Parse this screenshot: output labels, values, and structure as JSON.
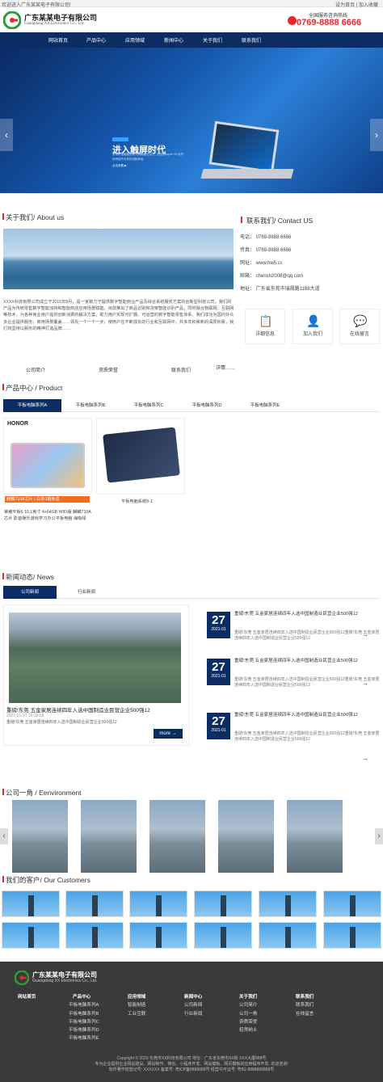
{
  "topbar": {
    "welcome": "欢迎进入广东某某电子有限公司!",
    "links": [
      "设为首页",
      "|",
      "加入收藏"
    ]
  },
  "header": {
    "company_cn": "广东某某电子有限公司",
    "company_en": "Guangdong XX Electronics Co., Ltd.",
    "hotline_label": "全国服务咨询热线",
    "hotline": "0769-8888 6666"
  },
  "nav": [
    "网站首页",
    "产品中心",
    "应用领域",
    "新闻中心",
    "关于我们",
    "联系我们"
  ],
  "banner": {
    "tag": "Aspire V5",
    "headline": "进入触屏时代",
    "sub1": "采用防误触触控和大屏幕触控设计, 让您的Aspire V5 系列",
    "sub2": "获得前所未有的流畅体验",
    "button": "点击查看 ▶",
    "prev": "‹",
    "next": "›"
  },
  "about": {
    "title": "关于我们/ About us",
    "text": "XXXX科技有限公司成立于2015年8月，是一家致力于提供数字智能商业产品及综合系统服务方案的创新型科技公司。我们的产品为传统零售数字智能加持和智能商店应用场景赋能。目前推出了商品识别和货架智能识别产品，同时融合物联网、互联网等技术，为各种商业用户提供创新消费的解决方案，助力用户实现可扩展、可运营的数字智能零售体系。我们成功为国内外众多企业提供服务，商用场景覆盖……领先一个一个一步，使用户在不断成长的行业和互联网中，并多年积累新的深厚积累，我们将坚持以服务的精神打造品牌……",
    "links": [
      "公司简介",
      "资质荣誉",
      "联系我们",
      "详情……"
    ]
  },
  "contact": {
    "title": "联系我们/ Contact US",
    "rows": [
      "电话：   0769-8888 6666",
      "传真：   0769-8888 6666",
      "网址：   www.hw5.cc",
      "邮箱：   chensh2008@qq.com",
      "地址：   广东省东莞市瑞晟路1188大道"
    ],
    "boxes": [
      {
        "icon": "📋",
        "label": "详细信息"
      },
      {
        "icon": "👤",
        "label": "加入我们"
      },
      {
        "icon": "💬",
        "label": "在线留言"
      }
    ]
  },
  "product": {
    "title": "产品中心 / Product",
    "tabs": [
      "平板电脑系列A",
      "平板电脑系列B",
      "平板电脑系列C",
      "平板电脑系列D",
      "平板电脑系列E"
    ],
    "items": [
      {
        "brand": "HONOR",
        "badge": "麒麟710A芯片 | 白条3期免息",
        "caption": "荣耀平板6 10.1英寸 4+64GB WIFI版 麒麟710A芯片 影音娱乐游戏学习办公平板电脑 海吸绿"
      },
      {
        "caption": "平板电脑系统8-1"
      }
    ]
  },
  "news": {
    "title": "新闻动态/ News",
    "tabs": [
      "公司新闻",
      "行业新闻"
    ],
    "main": {
      "title": "重磅!东莞 五金家居连续四年入选中国制造业民营企业500强12",
      "date": "2021-01-27 10:38:58",
      "desc": "重磅!东莞 五金家居连续四年入选中国制造业民营企业500强12",
      "more": "more →"
    },
    "list": [
      {
        "day": "27",
        "ym": "2021-01",
        "title": "重磅!东莞 五金家居连续四年入选中国制造业民营企业500强12",
        "desc": "重磅!东莞 五金家居连续四年入选中国制造业民营企业500强12重磅!东莞 五金家居连续四年入选中国制造业民营企业500强12",
        "arrow": "→"
      },
      {
        "day": "27",
        "ym": "2021-01",
        "title": "重磅!东莞 五金家居连续四年入选中国制造业民营企业500强12",
        "desc": "重磅!东莞 五金家居连续四年入选中国制造业民营企业500强12重磅!东莞 五金家居连续四年入选中国制造业民营企业500强12",
        "arrow": "→"
      },
      {
        "day": "27",
        "ym": "2021-01",
        "title": "重磅!东莞 五金家居连续四年入选中国制造业民营企业500强12",
        "desc": "重磅!东莞 五金家居连续四年入选中国制造业民营企业500强12重磅!东莞 五金家居连续四年入选中国制造业民营企业500强12",
        "arrow": "→"
      }
    ]
  },
  "environment": {
    "title": "公司一角 / Eenvironment",
    "prev": "‹",
    "next": "›"
  },
  "customers": {
    "title": "我们的客户/ Our Customers"
  },
  "footer": {
    "company_cn": "广东某某电子有限公司",
    "company_en": "Guangdong XX Electronics Co., Ltd.",
    "cols": [
      {
        "head": "网站首页",
        "items": []
      },
      {
        "head": "产品中心",
        "items": [
          "平板电脑系列A",
          "平板电脑系列B",
          "平板电脑系列C",
          "平板电脑系列D",
          "平板电脑系列E"
        ]
      },
      {
        "head": "应用领域",
        "items": [
          "智能制造",
          "工业互联"
        ]
      },
      {
        "head": "新闻中心",
        "items": [
          "公司新闻",
          "行业新闻"
        ]
      },
      {
        "head": "关于我们",
        "items": [
          "公司简介",
          "公司一角",
          "资质荣誉",
          "招贤纳士"
        ]
      },
      {
        "head": "联系我们",
        "items": [
          "联系我们",
          "在线留言"
        ]
      }
    ],
    "line1": "Copyright © 2020 东莞市XX科技有限公司 地址：广东省东莞市XX街 XXX大厦888号",
    "line2": "专为企业提供企业网站建设、网站制作、微信、小程序开发、网站模板、网页模板的应用程序开发, 欢迎咨询!",
    "line3": "软件著作权登记号: XXXXXX 备案号: 粤ICP备8888888号 经营许可证号: 粤B2-8888888888号"
  }
}
